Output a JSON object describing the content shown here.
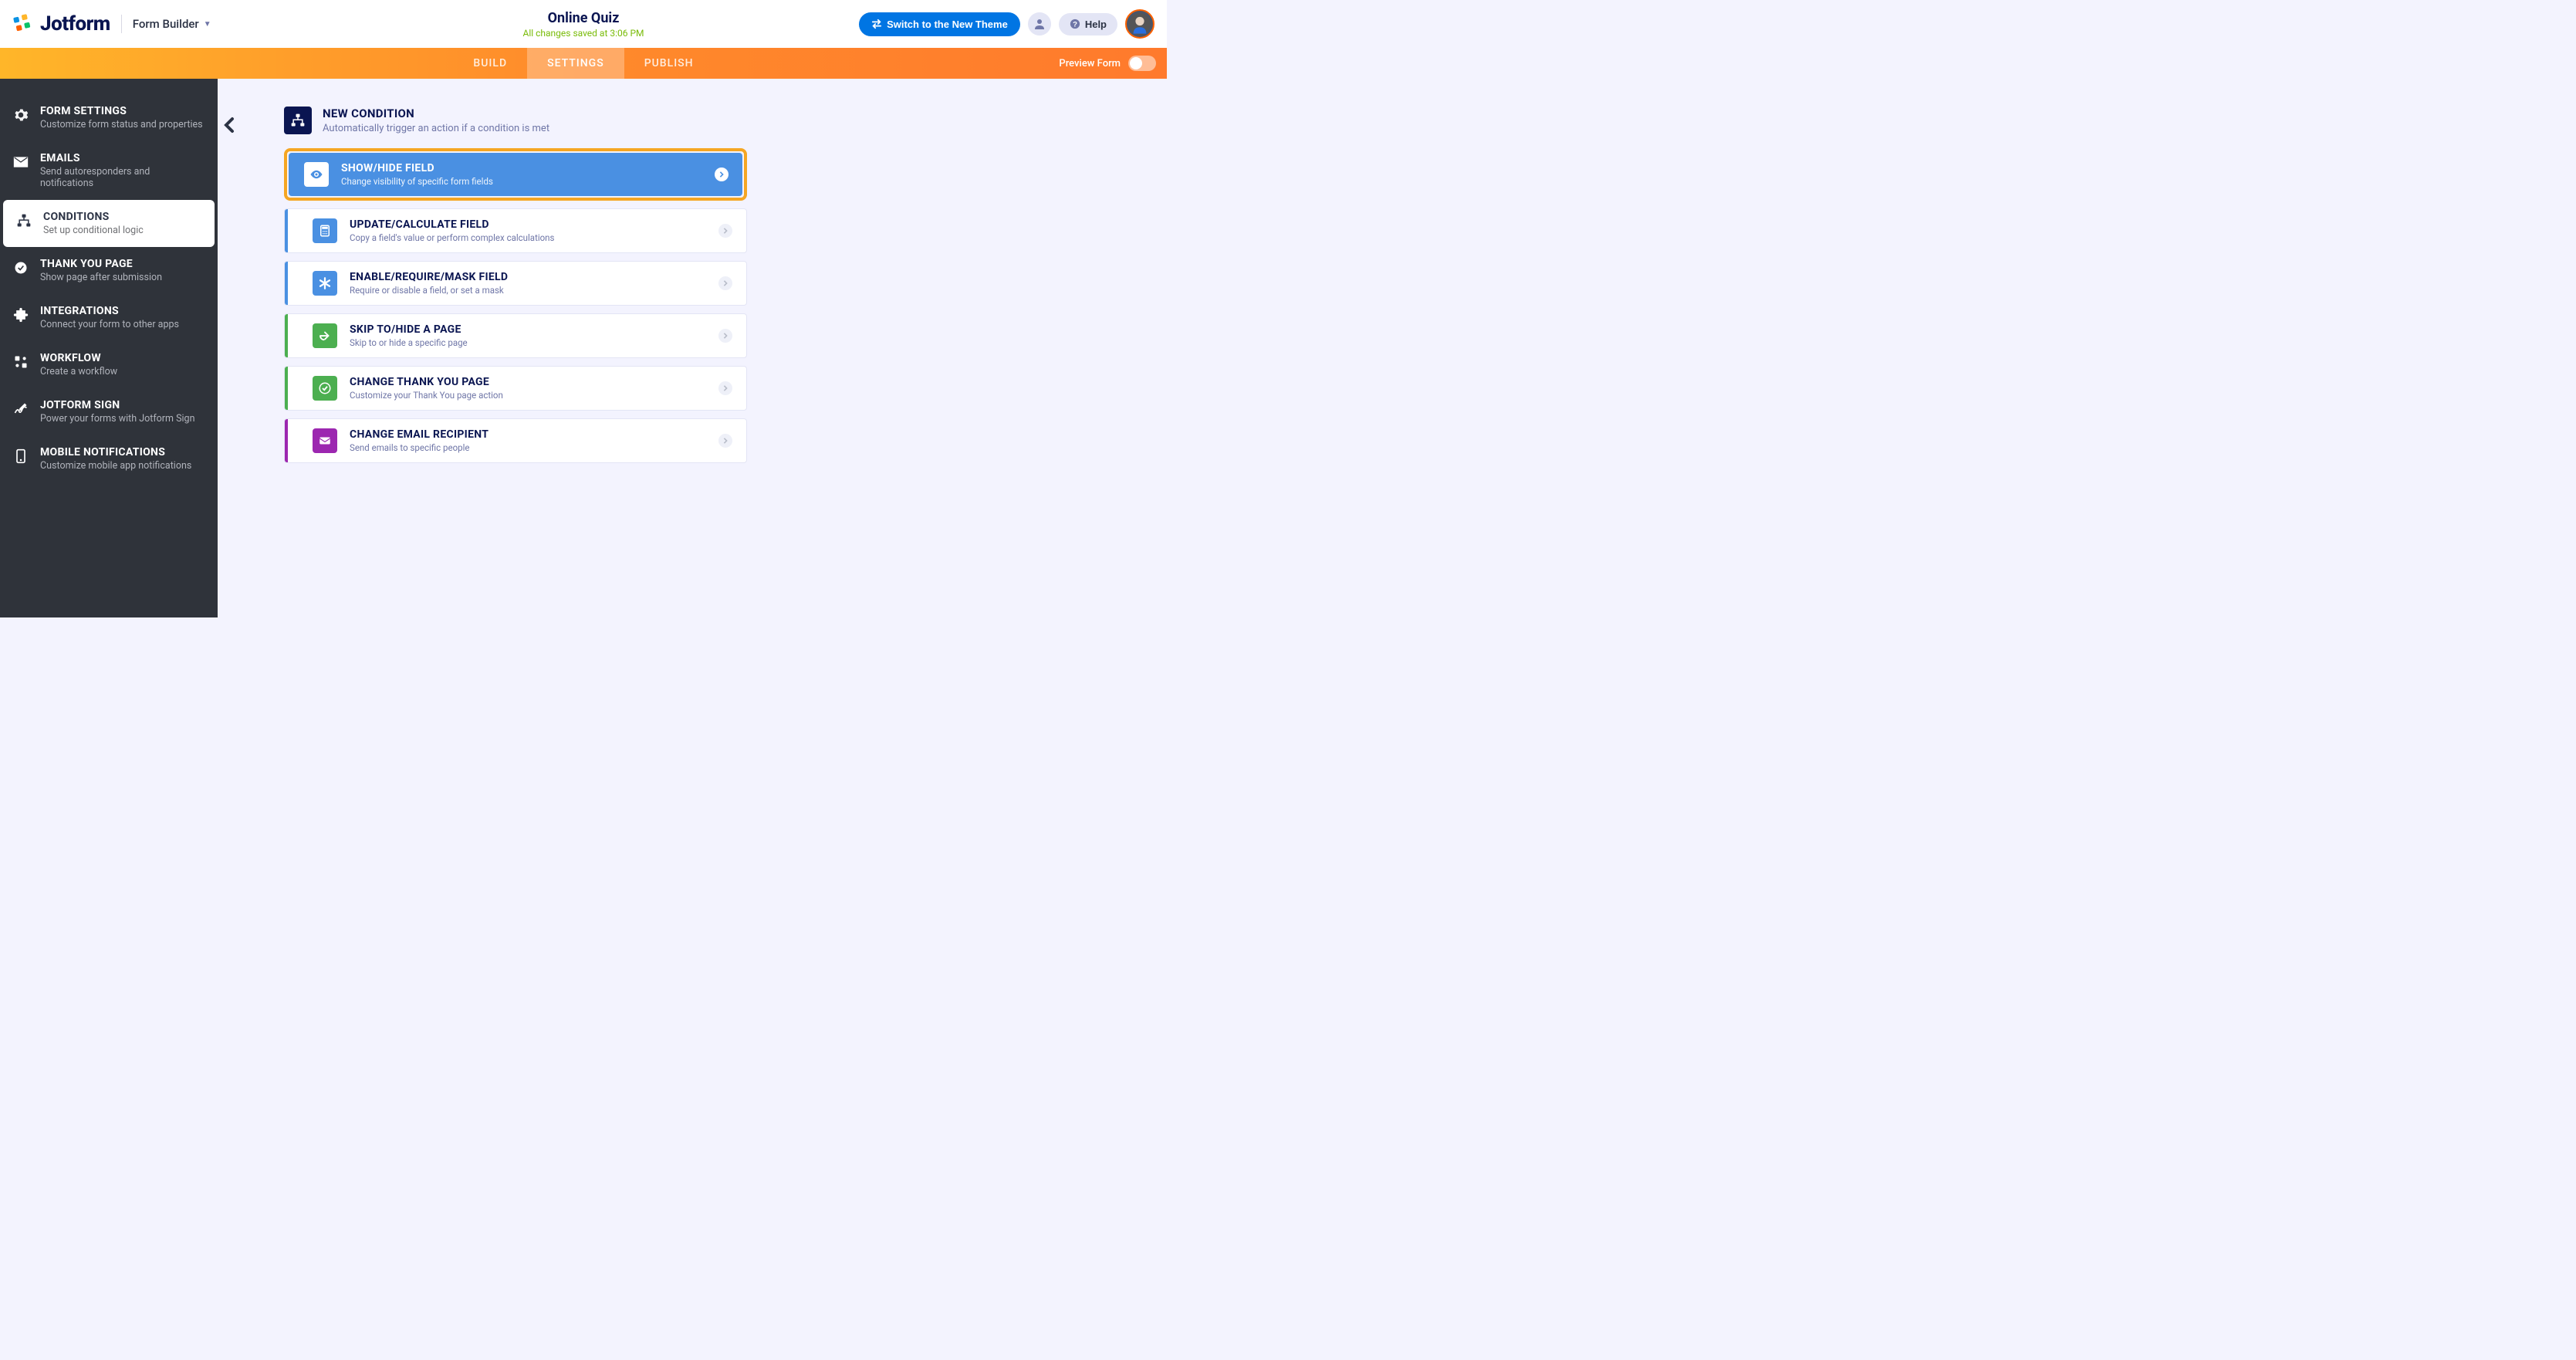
{
  "header": {
    "brand": "Jotform",
    "form_builder_label": "Form Builder",
    "form_title": "Online Quiz",
    "save_status": "All changes saved at 3:06 PM",
    "switch_theme": "Switch to the New Theme",
    "help_label": "Help"
  },
  "tabs": {
    "build": "BUILD",
    "settings": "SETTINGS",
    "publish": "PUBLISH",
    "preview_label": "Preview Form"
  },
  "sidebar": [
    {
      "id": "form-settings",
      "title": "FORM SETTINGS",
      "sub": "Customize form status and properties"
    },
    {
      "id": "emails",
      "title": "EMAILS",
      "sub": "Send autoresponders and notifications"
    },
    {
      "id": "conditions",
      "title": "CONDITIONS",
      "sub": "Set up conditional logic"
    },
    {
      "id": "thank-you",
      "title": "THANK YOU PAGE",
      "sub": "Show page after submission"
    },
    {
      "id": "integrations",
      "title": "INTEGRATIONS",
      "sub": "Connect your form to other apps"
    },
    {
      "id": "workflow",
      "title": "WORKFLOW",
      "sub": "Create a workflow"
    },
    {
      "id": "jotform-sign",
      "title": "JOTFORM SIGN",
      "sub": "Power your forms with Jotform Sign"
    },
    {
      "id": "mobile-notifications",
      "title": "MOBILE NOTIFICATIONS",
      "sub": "Customize mobile app notifications"
    }
  ],
  "panel": {
    "title": "NEW CONDITION",
    "sub": "Automatically trigger an action if a condition is met"
  },
  "conditions": [
    {
      "id": "show-hide",
      "title": "SHOW/HIDE FIELD",
      "sub": "Change visibility of specific form fields",
      "accent": "blue",
      "highlighted": true
    },
    {
      "id": "update-calculate",
      "title": "UPDATE/CALCULATE FIELD",
      "sub": "Copy a field's value or perform complex calculations",
      "accent": "blue"
    },
    {
      "id": "enable-require-mask",
      "title": "ENABLE/REQUIRE/MASK FIELD",
      "sub": "Require or disable a field, or set a mask",
      "accent": "blue"
    },
    {
      "id": "skip-hide-page",
      "title": "SKIP TO/HIDE A PAGE",
      "sub": "Skip to or hide a specific page",
      "accent": "green"
    },
    {
      "id": "change-thankyou",
      "title": "CHANGE THANK YOU PAGE",
      "sub": "Customize your Thank You page action",
      "accent": "green"
    },
    {
      "id": "change-email",
      "title": "CHANGE EMAIL RECIPIENT",
      "sub": "Send emails to specific people",
      "accent": "purple"
    }
  ],
  "colors": {
    "brand_orange": "#ff6100",
    "primary_blue": "#0075e3",
    "highlight_blue": "#4a90e2",
    "highlight_border": "#f5a623",
    "accent_green": "#4caf50",
    "accent_purple": "#9c27b0",
    "dark_navy": "#0a1551"
  }
}
